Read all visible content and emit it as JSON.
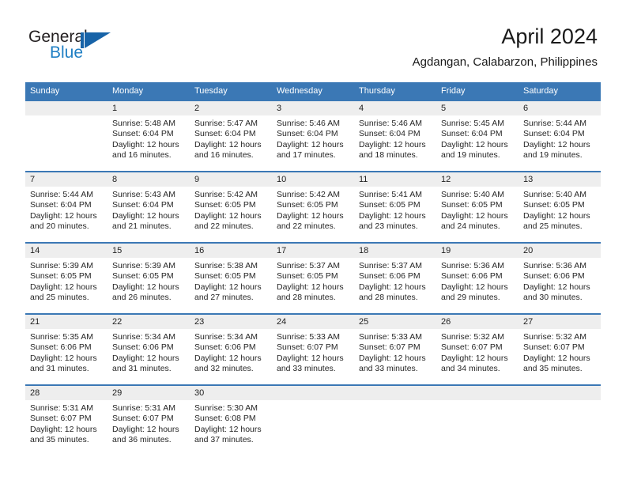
{
  "brand": {
    "name_part1": "General",
    "name_part2": "Blue",
    "logo_icon": "triangle-flag-icon",
    "color_dark": "#231f20",
    "color_blue": "#1f7fc4",
    "color_mark": "#1763a8"
  },
  "header": {
    "title": "April 2024",
    "subtitle": "Agdangan, Calabarzon, Philippines"
  },
  "theme": {
    "header_bg": "#3b78b5",
    "header_text": "#ffffff",
    "daynum_band": "#eeeeee",
    "grid_line": "#3b78b5"
  },
  "weekday_headers": [
    "Sunday",
    "Monday",
    "Tuesday",
    "Wednesday",
    "Thursday",
    "Friday",
    "Saturday"
  ],
  "weeks": [
    [
      {
        "day": "",
        "sunrise": "",
        "sunset": "",
        "daylight_line1": "",
        "daylight_line2": ""
      },
      {
        "day": "1",
        "sunrise": "Sunrise: 5:48 AM",
        "sunset": "Sunset: 6:04 PM",
        "daylight_line1": "Daylight: 12 hours",
        "daylight_line2": "and 16 minutes."
      },
      {
        "day": "2",
        "sunrise": "Sunrise: 5:47 AM",
        "sunset": "Sunset: 6:04 PM",
        "daylight_line1": "Daylight: 12 hours",
        "daylight_line2": "and 16 minutes."
      },
      {
        "day": "3",
        "sunrise": "Sunrise: 5:46 AM",
        "sunset": "Sunset: 6:04 PM",
        "daylight_line1": "Daylight: 12 hours",
        "daylight_line2": "and 17 minutes."
      },
      {
        "day": "4",
        "sunrise": "Sunrise: 5:46 AM",
        "sunset": "Sunset: 6:04 PM",
        "daylight_line1": "Daylight: 12 hours",
        "daylight_line2": "and 18 minutes."
      },
      {
        "day": "5",
        "sunrise": "Sunrise: 5:45 AM",
        "sunset": "Sunset: 6:04 PM",
        "daylight_line1": "Daylight: 12 hours",
        "daylight_line2": "and 19 minutes."
      },
      {
        "day": "6",
        "sunrise": "Sunrise: 5:44 AM",
        "sunset": "Sunset: 6:04 PM",
        "daylight_line1": "Daylight: 12 hours",
        "daylight_line2": "and 19 minutes."
      }
    ],
    [
      {
        "day": "7",
        "sunrise": "Sunrise: 5:44 AM",
        "sunset": "Sunset: 6:04 PM",
        "daylight_line1": "Daylight: 12 hours",
        "daylight_line2": "and 20 minutes."
      },
      {
        "day": "8",
        "sunrise": "Sunrise: 5:43 AM",
        "sunset": "Sunset: 6:04 PM",
        "daylight_line1": "Daylight: 12 hours",
        "daylight_line2": "and 21 minutes."
      },
      {
        "day": "9",
        "sunrise": "Sunrise: 5:42 AM",
        "sunset": "Sunset: 6:05 PM",
        "daylight_line1": "Daylight: 12 hours",
        "daylight_line2": "and 22 minutes."
      },
      {
        "day": "10",
        "sunrise": "Sunrise: 5:42 AM",
        "sunset": "Sunset: 6:05 PM",
        "daylight_line1": "Daylight: 12 hours",
        "daylight_line2": "and 22 minutes."
      },
      {
        "day": "11",
        "sunrise": "Sunrise: 5:41 AM",
        "sunset": "Sunset: 6:05 PM",
        "daylight_line1": "Daylight: 12 hours",
        "daylight_line2": "and 23 minutes."
      },
      {
        "day": "12",
        "sunrise": "Sunrise: 5:40 AM",
        "sunset": "Sunset: 6:05 PM",
        "daylight_line1": "Daylight: 12 hours",
        "daylight_line2": "and 24 minutes."
      },
      {
        "day": "13",
        "sunrise": "Sunrise: 5:40 AM",
        "sunset": "Sunset: 6:05 PM",
        "daylight_line1": "Daylight: 12 hours",
        "daylight_line2": "and 25 minutes."
      }
    ],
    [
      {
        "day": "14",
        "sunrise": "Sunrise: 5:39 AM",
        "sunset": "Sunset: 6:05 PM",
        "daylight_line1": "Daylight: 12 hours",
        "daylight_line2": "and 25 minutes."
      },
      {
        "day": "15",
        "sunrise": "Sunrise: 5:39 AM",
        "sunset": "Sunset: 6:05 PM",
        "daylight_line1": "Daylight: 12 hours",
        "daylight_line2": "and 26 minutes."
      },
      {
        "day": "16",
        "sunrise": "Sunrise: 5:38 AM",
        "sunset": "Sunset: 6:05 PM",
        "daylight_line1": "Daylight: 12 hours",
        "daylight_line2": "and 27 minutes."
      },
      {
        "day": "17",
        "sunrise": "Sunrise: 5:37 AM",
        "sunset": "Sunset: 6:05 PM",
        "daylight_line1": "Daylight: 12 hours",
        "daylight_line2": "and 28 minutes."
      },
      {
        "day": "18",
        "sunrise": "Sunrise: 5:37 AM",
        "sunset": "Sunset: 6:06 PM",
        "daylight_line1": "Daylight: 12 hours",
        "daylight_line2": "and 28 minutes."
      },
      {
        "day": "19",
        "sunrise": "Sunrise: 5:36 AM",
        "sunset": "Sunset: 6:06 PM",
        "daylight_line1": "Daylight: 12 hours",
        "daylight_line2": "and 29 minutes."
      },
      {
        "day": "20",
        "sunrise": "Sunrise: 5:36 AM",
        "sunset": "Sunset: 6:06 PM",
        "daylight_line1": "Daylight: 12 hours",
        "daylight_line2": "and 30 minutes."
      }
    ],
    [
      {
        "day": "21",
        "sunrise": "Sunrise: 5:35 AM",
        "sunset": "Sunset: 6:06 PM",
        "daylight_line1": "Daylight: 12 hours",
        "daylight_line2": "and 31 minutes."
      },
      {
        "day": "22",
        "sunrise": "Sunrise: 5:34 AM",
        "sunset": "Sunset: 6:06 PM",
        "daylight_line1": "Daylight: 12 hours",
        "daylight_line2": "and 31 minutes."
      },
      {
        "day": "23",
        "sunrise": "Sunrise: 5:34 AM",
        "sunset": "Sunset: 6:06 PM",
        "daylight_line1": "Daylight: 12 hours",
        "daylight_line2": "and 32 minutes."
      },
      {
        "day": "24",
        "sunrise": "Sunrise: 5:33 AM",
        "sunset": "Sunset: 6:07 PM",
        "daylight_line1": "Daylight: 12 hours",
        "daylight_line2": "and 33 minutes."
      },
      {
        "day": "25",
        "sunrise": "Sunrise: 5:33 AM",
        "sunset": "Sunset: 6:07 PM",
        "daylight_line1": "Daylight: 12 hours",
        "daylight_line2": "and 33 minutes."
      },
      {
        "day": "26",
        "sunrise": "Sunrise: 5:32 AM",
        "sunset": "Sunset: 6:07 PM",
        "daylight_line1": "Daylight: 12 hours",
        "daylight_line2": "and 34 minutes."
      },
      {
        "day": "27",
        "sunrise": "Sunrise: 5:32 AM",
        "sunset": "Sunset: 6:07 PM",
        "daylight_line1": "Daylight: 12 hours",
        "daylight_line2": "and 35 minutes."
      }
    ],
    [
      {
        "day": "28",
        "sunrise": "Sunrise: 5:31 AM",
        "sunset": "Sunset: 6:07 PM",
        "daylight_line1": "Daylight: 12 hours",
        "daylight_line2": "and 35 minutes."
      },
      {
        "day": "29",
        "sunrise": "Sunrise: 5:31 AM",
        "sunset": "Sunset: 6:07 PM",
        "daylight_line1": "Daylight: 12 hours",
        "daylight_line2": "and 36 minutes."
      },
      {
        "day": "30",
        "sunrise": "Sunrise: 5:30 AM",
        "sunset": "Sunset: 6:08 PM",
        "daylight_line1": "Daylight: 12 hours",
        "daylight_line2": "and 37 minutes."
      },
      {
        "day": "",
        "sunrise": "",
        "sunset": "",
        "daylight_line1": "",
        "daylight_line2": ""
      },
      {
        "day": "",
        "sunrise": "",
        "sunset": "",
        "daylight_line1": "",
        "daylight_line2": ""
      },
      {
        "day": "",
        "sunrise": "",
        "sunset": "",
        "daylight_line1": "",
        "daylight_line2": ""
      },
      {
        "day": "",
        "sunrise": "",
        "sunset": "",
        "daylight_line1": "",
        "daylight_line2": ""
      }
    ]
  ]
}
